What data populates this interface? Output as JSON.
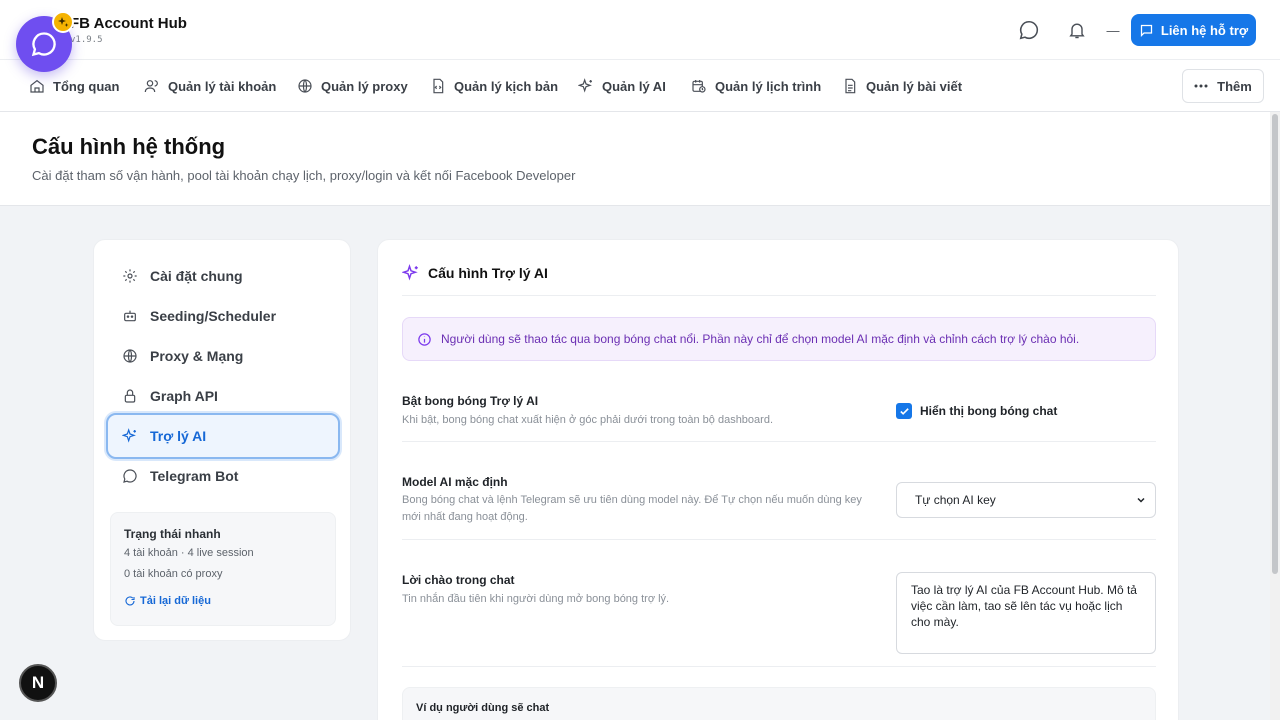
{
  "app": {
    "title": "FB Account Hub",
    "version": "v1.9.5"
  },
  "header": {
    "support_label": "Liên hệ hỗ trợ",
    "minimize_glyph": "—"
  },
  "nav": {
    "items": [
      {
        "label": "Tổng quan",
        "icon": "home-icon"
      },
      {
        "label": "Quản lý tài khoản",
        "icon": "users-icon"
      },
      {
        "label": "Quản lý proxy",
        "icon": "globe-icon"
      },
      {
        "label": "Quản lý kịch bản",
        "icon": "script-file-icon"
      },
      {
        "label": "Quản lý AI",
        "icon": "sparkles-icon"
      },
      {
        "label": "Quản lý lịch trình",
        "icon": "calendar-clock-icon"
      },
      {
        "label": "Quản lý bài viết",
        "icon": "document-icon"
      }
    ],
    "more_label": "Thêm"
  },
  "page": {
    "title": "Cấu hình hệ thống",
    "subtitle": "Cài đặt tham số vận hành, pool tài khoản chạy lịch, proxy/login và kết nối Facebook Developer"
  },
  "sidebar": {
    "items": [
      {
        "label": "Cài đặt chung",
        "icon": "gear-icon"
      },
      {
        "label": "Seeding/Scheduler",
        "icon": "bot-icon"
      },
      {
        "label": "Proxy & Mạng",
        "icon": "globe-icon"
      },
      {
        "label": "Graph API",
        "icon": "lock-icon"
      },
      {
        "label": "Trợ lý AI",
        "icon": "sparkles-icon",
        "active": true
      },
      {
        "label": "Telegram Bot",
        "icon": "chat-icon"
      }
    ],
    "quick": {
      "title": "Trạng thái nhanh",
      "line1": "4 tài khoản · 4 live session",
      "line2": "0 tài khoản có proxy",
      "reload_label": "Tải lại dữ liệu"
    }
  },
  "main": {
    "title": "Cấu hình Trợ lý AI",
    "info": "Người dùng sẽ thao tác qua bong bóng chat nổi. Phần này chỉ để chọn model AI mặc định và chỉnh cách trợ lý chào hỏi.",
    "enable": {
      "label": "Bật bong bóng Trợ lý AI",
      "desc": "Khi bật, bong bóng chat xuất hiện ở góc phải dưới trong toàn bộ dashboard.",
      "checkbox_label": "Hiển thị bong bóng chat",
      "checked": true
    },
    "model": {
      "label": "Model AI mặc định",
      "desc": "Bong bóng chat và lệnh Telegram sẽ ưu tiên dùng model này. Để Tự chọn nếu muốn dùng key mới nhất đang hoạt động.",
      "selected": "Tự chọn AI key"
    },
    "greeting": {
      "label": "Lời chào trong chat",
      "desc": "Tin nhắn đầu tiên khi người dùng mở bong bóng trợ lý.",
      "value": "Tao là trợ lý AI của FB Account Hub. Mô tả việc cần làm, tao sẽ lên tác vụ hoặc lịch cho mày."
    },
    "example_title": "Ví dụ người dùng sẽ chat"
  },
  "dev_badge": "N",
  "colors": {
    "accent": "#1677e8",
    "ai_purple": "#6f4ef0",
    "badge_yellow": "#f5b301"
  }
}
